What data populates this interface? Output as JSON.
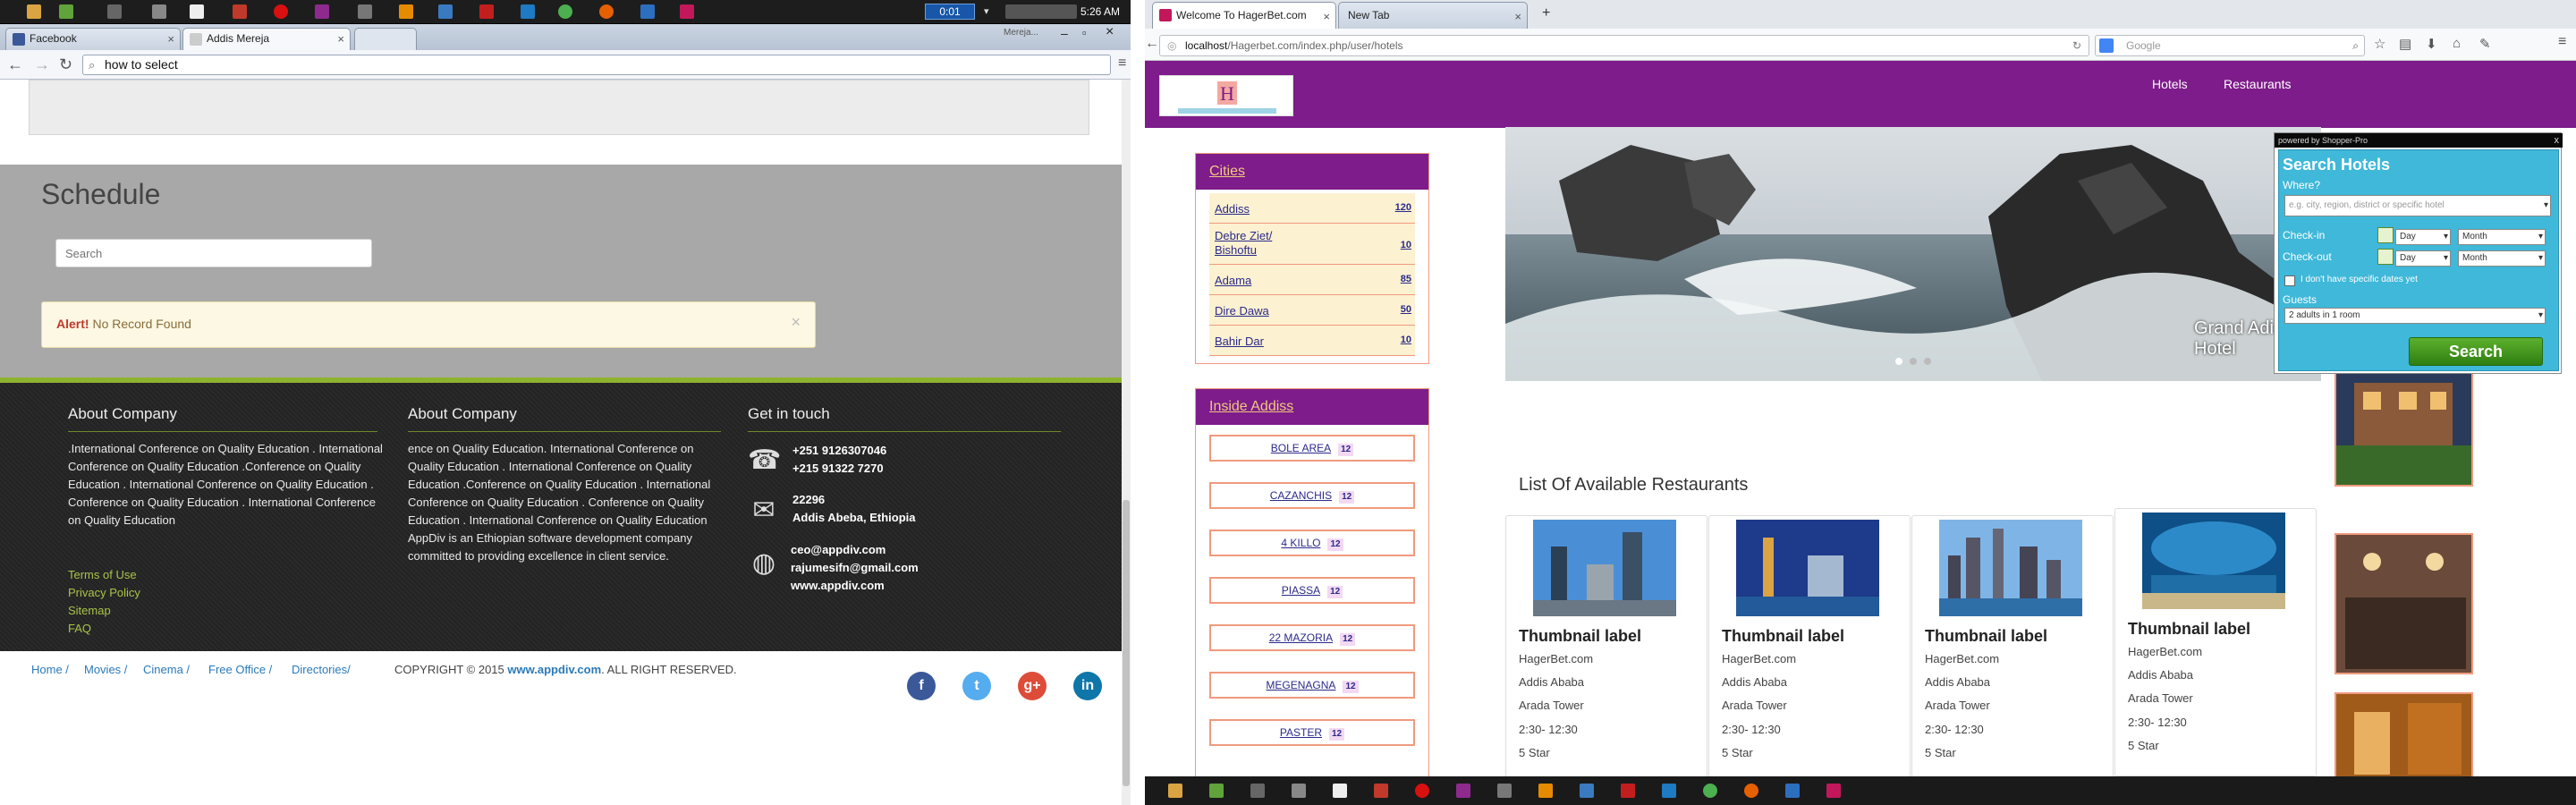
{
  "left_screen": {
    "taskbar": {
      "clock_badge": "0:01",
      "time": "5:26 AM"
    },
    "tabs": [
      {
        "label": "Facebook",
        "active": false
      },
      {
        "label": "Addis Mereja",
        "active": true
      }
    ],
    "window_title_hint": "Mereja...",
    "address_bar": {
      "value": "how to select"
    },
    "schedule": {
      "title": "Schedule",
      "search_placeholder": "Search",
      "alert_strong": "Alert!",
      "alert_text": "No Record Found",
      "alert_close": "×"
    },
    "footer": {
      "col1": {
        "title": "About Company",
        "text": ".International Conference on Quality Education . International Conference on Quality Education .Conference on Quality Education . International Conference on Quality Education . Conference on Quality Education . International Conference on Quality Education",
        "links": [
          "Terms of Use",
          "Privacy Policy",
          "Sitemap",
          "FAQ"
        ]
      },
      "col2": {
        "title": "About Company",
        "text": "ence on Quality Education. International Conference on Quality Education . International Conference on Quality Education .Conference on Quality Education . International Conference on Quality Education . Conference on Quality Education . International Conference on Quality Education AppDiv is an Ethiopian software development company committed to providing excellence in client service."
      },
      "col3": {
        "title": "Get in touch",
        "phones": [
          "+251 9126307046",
          "+215 91322 7270"
        ],
        "address": [
          "22296",
          "Addis Abeba, Ethiopia"
        ],
        "emails": [
          "ceo@appdiv.com",
          "rajumesifn@gmail.com",
          "www.appdiv.com"
        ]
      }
    },
    "bottom": {
      "breadcrumbs": [
        "Home /",
        "Movies /",
        "Cinema /",
        "Free Office /",
        "Directories/"
      ],
      "copyright_prefix": "COPYRIGHT © 2015",
      "copyright_link": "www.appdiv.com",
      "copyright_suffix": ". ALL RIGHT RESERVED."
    },
    "social": [
      {
        "icon": "facebook-icon",
        "glyph": "f",
        "color": "#3b5998"
      },
      {
        "icon": "twitter-icon",
        "glyph": "t",
        "color": "#55acee"
      },
      {
        "icon": "google-plus-icon",
        "glyph": "g+",
        "color": "#dd4b39"
      },
      {
        "icon": "linkedin-icon",
        "glyph": "in",
        "color": "#0e76a8"
      }
    ]
  },
  "right_screen": {
    "tabs": [
      {
        "label": "Welcome To HagerBet.com",
        "active": true
      },
      {
        "label": "New Tab",
        "active": false
      }
    ],
    "address_bar": {
      "host": "localhost",
      "path": "/Hagerbet.com/index.php/user/hotels"
    },
    "search_engine": {
      "placeholder": "Google"
    },
    "site": {
      "nav": [
        "Hotels",
        "Restaurants"
      ],
      "cities_panel": {
        "title": "Cities",
        "items": [
          {
            "name": "Addiss",
            "count": "120"
          },
          {
            "name": "Debre Ziet/ Bishoftu",
            "count": "10"
          },
          {
            "name": "Adama",
            "count": "85"
          },
          {
            "name": "Dire Dawa",
            "count": "50"
          },
          {
            "name": "Bahir Dar",
            "count": "10"
          }
        ]
      },
      "inside_panel": {
        "title": "Inside Addiss",
        "items": [
          {
            "name": "BOLE AREA",
            "count": "12"
          },
          {
            "name": "CAZANCHIS",
            "count": "12"
          },
          {
            "name": "4 KILLO",
            "count": "12"
          },
          {
            "name": "PIASSA",
            "count": "12"
          },
          {
            "name": "22 MAZORIA",
            "count": "12"
          },
          {
            "name": "MEGENAGNA",
            "count": "12"
          },
          {
            "name": "PASTER",
            "count": "12"
          }
        ]
      },
      "slider": {
        "caption": "Grand Adiss Hotel"
      },
      "restaurants_title": "List Of Available Restaurants",
      "restaurants": [
        {
          "title": "Thumbnail label",
          "site": "HagerBet.com",
          "city": "Addis Ababa",
          "place": "Arada Tower",
          "hours": "2:30- 12:30",
          "rating": "5 Star"
        },
        {
          "title": "Thumbnail label",
          "site": "HagerBet.com",
          "city": "Addis Ababa",
          "place": "Arada Tower",
          "hours": "2:30- 12:30",
          "rating": "5 Star"
        },
        {
          "title": "Thumbnail label",
          "site": "HagerBet.com",
          "city": "Addis Ababa",
          "place": "Arada Tower",
          "hours": "2:30- 12:30",
          "rating": "5 Star"
        },
        {
          "title": "Thumbnail label",
          "site": "HagerBet.com",
          "city": "Addis Ababa",
          "place": "Arada Tower",
          "hours": "2:30- 12:30",
          "rating": "5 Star"
        }
      ],
      "search_popup": {
        "powered_by": "powered by Shopper-Pro",
        "close": "x",
        "title": "Search Hotels",
        "where_label": "Where?",
        "where_placeholder": "e.g. city, region, district or specific hotel",
        "checkin_label": "Check-in",
        "checkout_label": "Check-out",
        "day_option": "Day",
        "month_option": "Month",
        "no_dates_label": "I don't have specific dates yet",
        "guests_label": "Guests",
        "guests_value": "2 adults in 1 room",
        "search_button": "Search"
      }
    }
  }
}
